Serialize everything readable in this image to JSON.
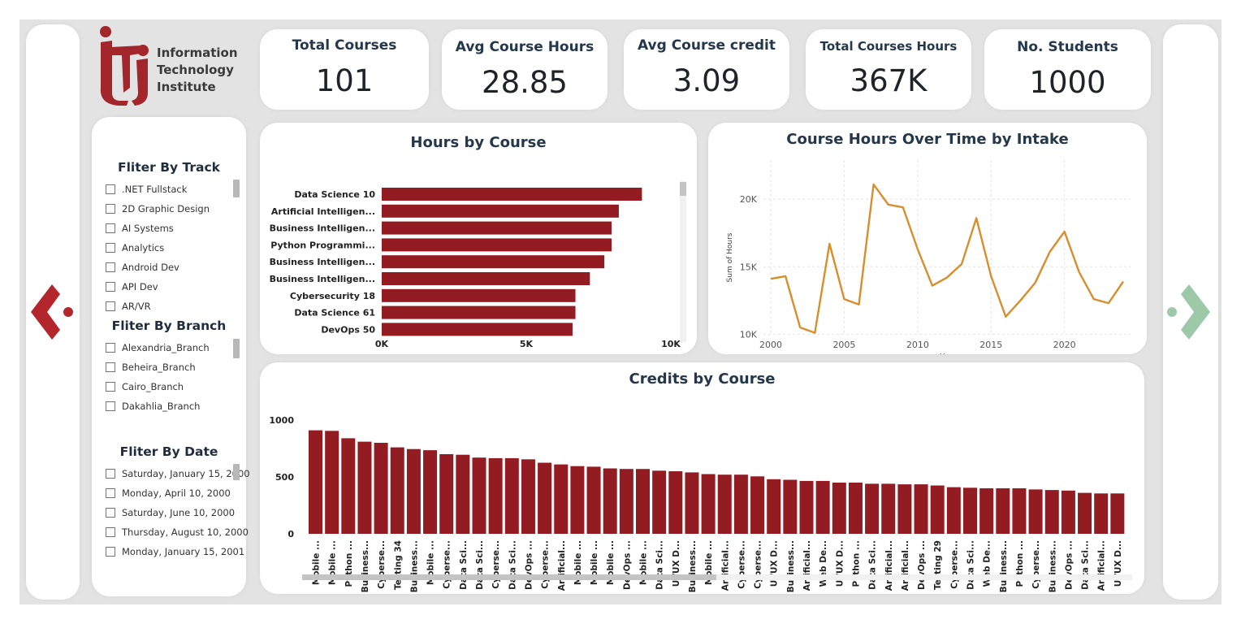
{
  "logo": {
    "letters": "iTi",
    "line1": "Information",
    "line2": "Technology",
    "line3": "Institute"
  },
  "kpis": [
    {
      "title": "Total Courses",
      "value": "101"
    },
    {
      "title": "Avg Course Hours",
      "value": "28.85"
    },
    {
      "title": "Avg Course credit",
      "value": "3.09"
    },
    {
      "title": "Total Courses Hours",
      "value": "367K"
    },
    {
      "title": "No. Students",
      "value": "1000"
    }
  ],
  "filters": {
    "track": {
      "title": "Fliter By Track",
      "items": [
        ".NET Fullstack",
        "2D Graphic Design",
        "AI Systems",
        "Analytics",
        "Android Dev",
        "API Dev",
        "AR/VR"
      ]
    },
    "branch": {
      "title": "Fliter By Branch",
      "items": [
        "Alexandria_Branch",
        "Beheira_Branch",
        "Cairo_Branch",
        "Dakahlia_Branch"
      ]
    },
    "date": {
      "title": "Fliter By Date",
      "items": [
        "Saturday, January 15, 2000",
        "Monday, April 10, 2000",
        "Saturday, June 10, 2000",
        "Thursday, August 10, 2000",
        "Monday, January 15, 2001"
      ]
    }
  },
  "colors": {
    "bar": "#931c22",
    "line": "#d98d2b",
    "prev_arrow": "#b3262c",
    "next_arrow": "#9ec9a8"
  },
  "nav": {
    "prev_icon": "chevron-left-icon",
    "next_icon": "chevron-right-icon"
  },
  "chart_data": [
    {
      "id": "hours",
      "type": "bar",
      "orientation": "horizontal",
      "title": "Hours by Course",
      "categories": [
        "Data Science 10",
        "Artificial Intelligen...",
        "Business Intelligen...",
        "Python Programmi...",
        "Business Intelligen...",
        "Business Intelligen...",
        "Cybersecurity 18",
        "Data Science 61",
        "DevOps 50"
      ],
      "values": [
        9000,
        8200,
        7950,
        7950,
        7700,
        7200,
        6700,
        6700,
        6600
      ],
      "xlim": [
        0,
        10000
      ],
      "xticks": [
        "0K",
        "5K",
        "10K"
      ]
    },
    {
      "id": "intake",
      "type": "line",
      "title": "Course Hours Over Time by Intake",
      "xlabel": "Year",
      "ylabel": "Sum of Hours",
      "x": [
        2000,
        2001,
        2002,
        2003,
        2004,
        2005,
        2006,
        2007,
        2008,
        2009,
        2010,
        2011,
        2012,
        2013,
        2014,
        2015,
        2016,
        2017,
        2018,
        2019,
        2020,
        2021,
        2022,
        2023,
        2024
      ],
      "values": [
        14100,
        14300,
        10500,
        10100,
        16700,
        12600,
        12200,
        21100,
        19600,
        19400,
        16300,
        13600,
        14200,
        15200,
        18600,
        14300,
        11300,
        12500,
        13800,
        16100,
        17600,
        14600,
        12600,
        12300,
        13900
      ],
      "xlim": [
        1999.5,
        2024.5
      ],
      "ylim": [
        9900,
        22900
      ],
      "xticks": [
        "2000",
        "2005",
        "2010",
        "2015",
        "2020"
      ],
      "yticks": [
        "10K",
        "15K",
        "20K"
      ],
      "grid": true
    },
    {
      "id": "credits",
      "type": "bar",
      "orientation": "vertical",
      "title": "Credits by Course",
      "categories": [
        "Mobile ...",
        "Mobile ...",
        "Python ...",
        "Business...",
        "Cyberse...",
        "Testing 34",
        "Business...",
        "Mobile ...",
        "Cyberse...",
        "Data Sci...",
        "Data Sci...",
        "Cyberse...",
        "Data Sci...",
        "DevOps ...",
        "Cyberse...",
        "Artificial...",
        "Mobile ...",
        "Mobile ...",
        "Mobile ...",
        "DevOps ...",
        "Mobile ...",
        "Data Sci...",
        "UI/UX D...",
        "Business...",
        "Mobile ...",
        "Artificial...",
        "Cyberse...",
        "Cyberse...",
        "UI/UX D...",
        "Business...",
        "Artificial...",
        "Web De...",
        "UI/UX D...",
        "Python ...",
        "Data Sci...",
        "Artificial...",
        "Artificial...",
        "DevOps ...",
        "Testing 29",
        "Cyberse...",
        "Data Sci...",
        "Web De...",
        "Business...",
        "Python ...",
        "Cyberse...",
        "Business...",
        "DevOps ...",
        "Data Sci...",
        "Artificial...",
        "UI/UX D..."
      ],
      "values": [
        910,
        905,
        840,
        810,
        800,
        760,
        745,
        735,
        700,
        695,
        670,
        665,
        665,
        655,
        625,
        610,
        595,
        590,
        575,
        570,
        570,
        555,
        550,
        540,
        525,
        520,
        520,
        505,
        480,
        475,
        465,
        465,
        450,
        450,
        440,
        440,
        435,
        435,
        425,
        410,
        405,
        400,
        400,
        400,
        390,
        385,
        380,
        360,
        355,
        355
      ],
      "ylim": [
        0,
        1000
      ],
      "yticks": [
        "0",
        "500",
        "1000"
      ]
    }
  ]
}
